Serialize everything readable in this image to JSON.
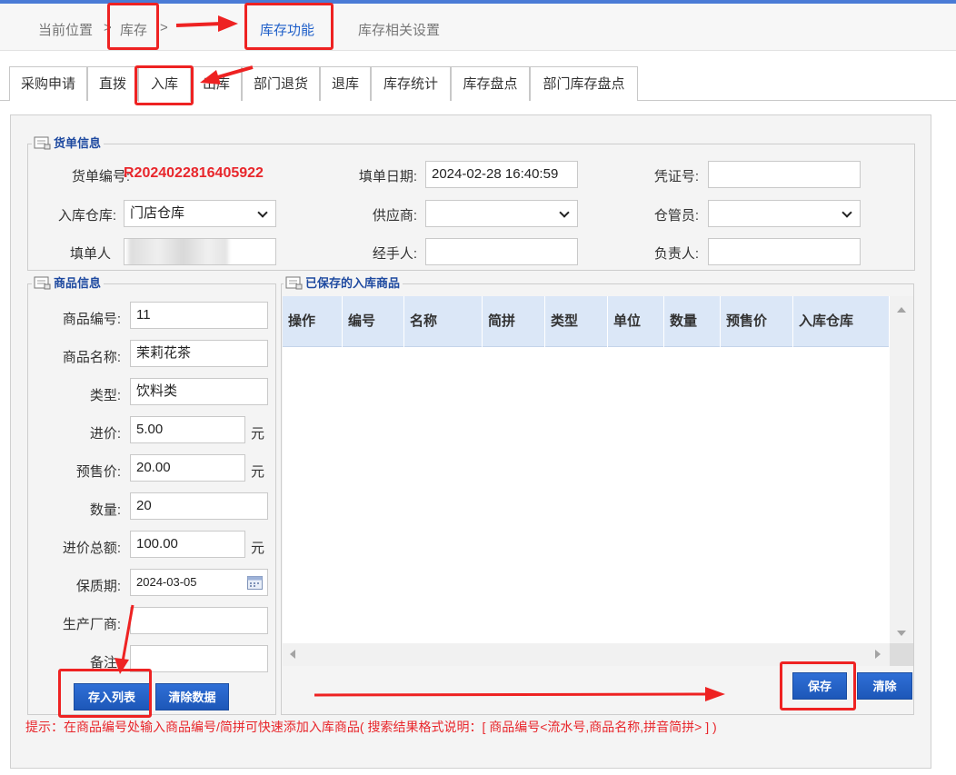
{
  "breadcrumb": {
    "prefix": "当前位置",
    "sep1": ">",
    "current": "库存",
    "sep2": ">",
    "func_tab": "库存功能",
    "settings_tab": "库存相关设置"
  },
  "tabs": [
    {
      "label": "采购申请"
    },
    {
      "label": "直拨"
    },
    {
      "label": "入库"
    },
    {
      "label": "出库"
    },
    {
      "label": "部门退货"
    },
    {
      "label": "退库"
    },
    {
      "label": "库存统计"
    },
    {
      "label": "库存盘点"
    },
    {
      "label": "部门库存盘点"
    }
  ],
  "bill": {
    "legend": "货单信息",
    "bill_no_label": "货单编号:",
    "bill_no_value": "R2024022816405922",
    "date_label": "填单日期:",
    "date_value": "2024-02-28 16:40:59",
    "voucher_label": "凭证号:",
    "voucher_value": "",
    "warehouse_label": "入库仓库:",
    "warehouse_value": "门店仓库",
    "supplier_label": "供应商:",
    "supplier_value": "",
    "keeper_label": "仓管员:",
    "keeper_value": "",
    "filler_label": "填单人",
    "handler_label": "经手人:",
    "handler_value": "",
    "owner_label": "负责人:",
    "owner_value": ""
  },
  "goods": {
    "legend": "商品信息",
    "code_label": "商品编号:",
    "code_value": "11",
    "name_label": "商品名称:",
    "name_value": "茉莉花茶",
    "type_label": "类型:",
    "type_value": "饮料类",
    "price_label": "进价:",
    "price_value": "5.00",
    "presale_label": "预售价:",
    "presale_value": "20.00",
    "qty_label": "数量:",
    "qty_value": "20",
    "total_label": "进价总额:",
    "total_value": "100.00",
    "expiry_label": "保质期:",
    "expiry_value": "2024-03-05",
    "maker_label": "生产厂商:",
    "maker_value": "",
    "note_label": "备注",
    "note_value": "",
    "unit": "元",
    "add_button": "存入列表",
    "clear_button": "清除数据"
  },
  "saved": {
    "legend": "已保存的入库商品",
    "columns": [
      "操作",
      "编号",
      "名称",
      "简拼",
      "类型",
      "单位",
      "数量",
      "预售价",
      "入库仓库"
    ],
    "save_button": "保存",
    "clear_button": "清除"
  },
  "hint": "提示：在商品编号处输入商品编号/简拼可快速添加入库商品( 搜索结果格式说明：[ 商品编号<流水号,商品名称,拼音简拼> ] )",
  "colors": {
    "accent": "#1d57b8",
    "annotation": "#ee2222",
    "bill_no": "#e8262b",
    "legend": "#1f4aa0"
  }
}
